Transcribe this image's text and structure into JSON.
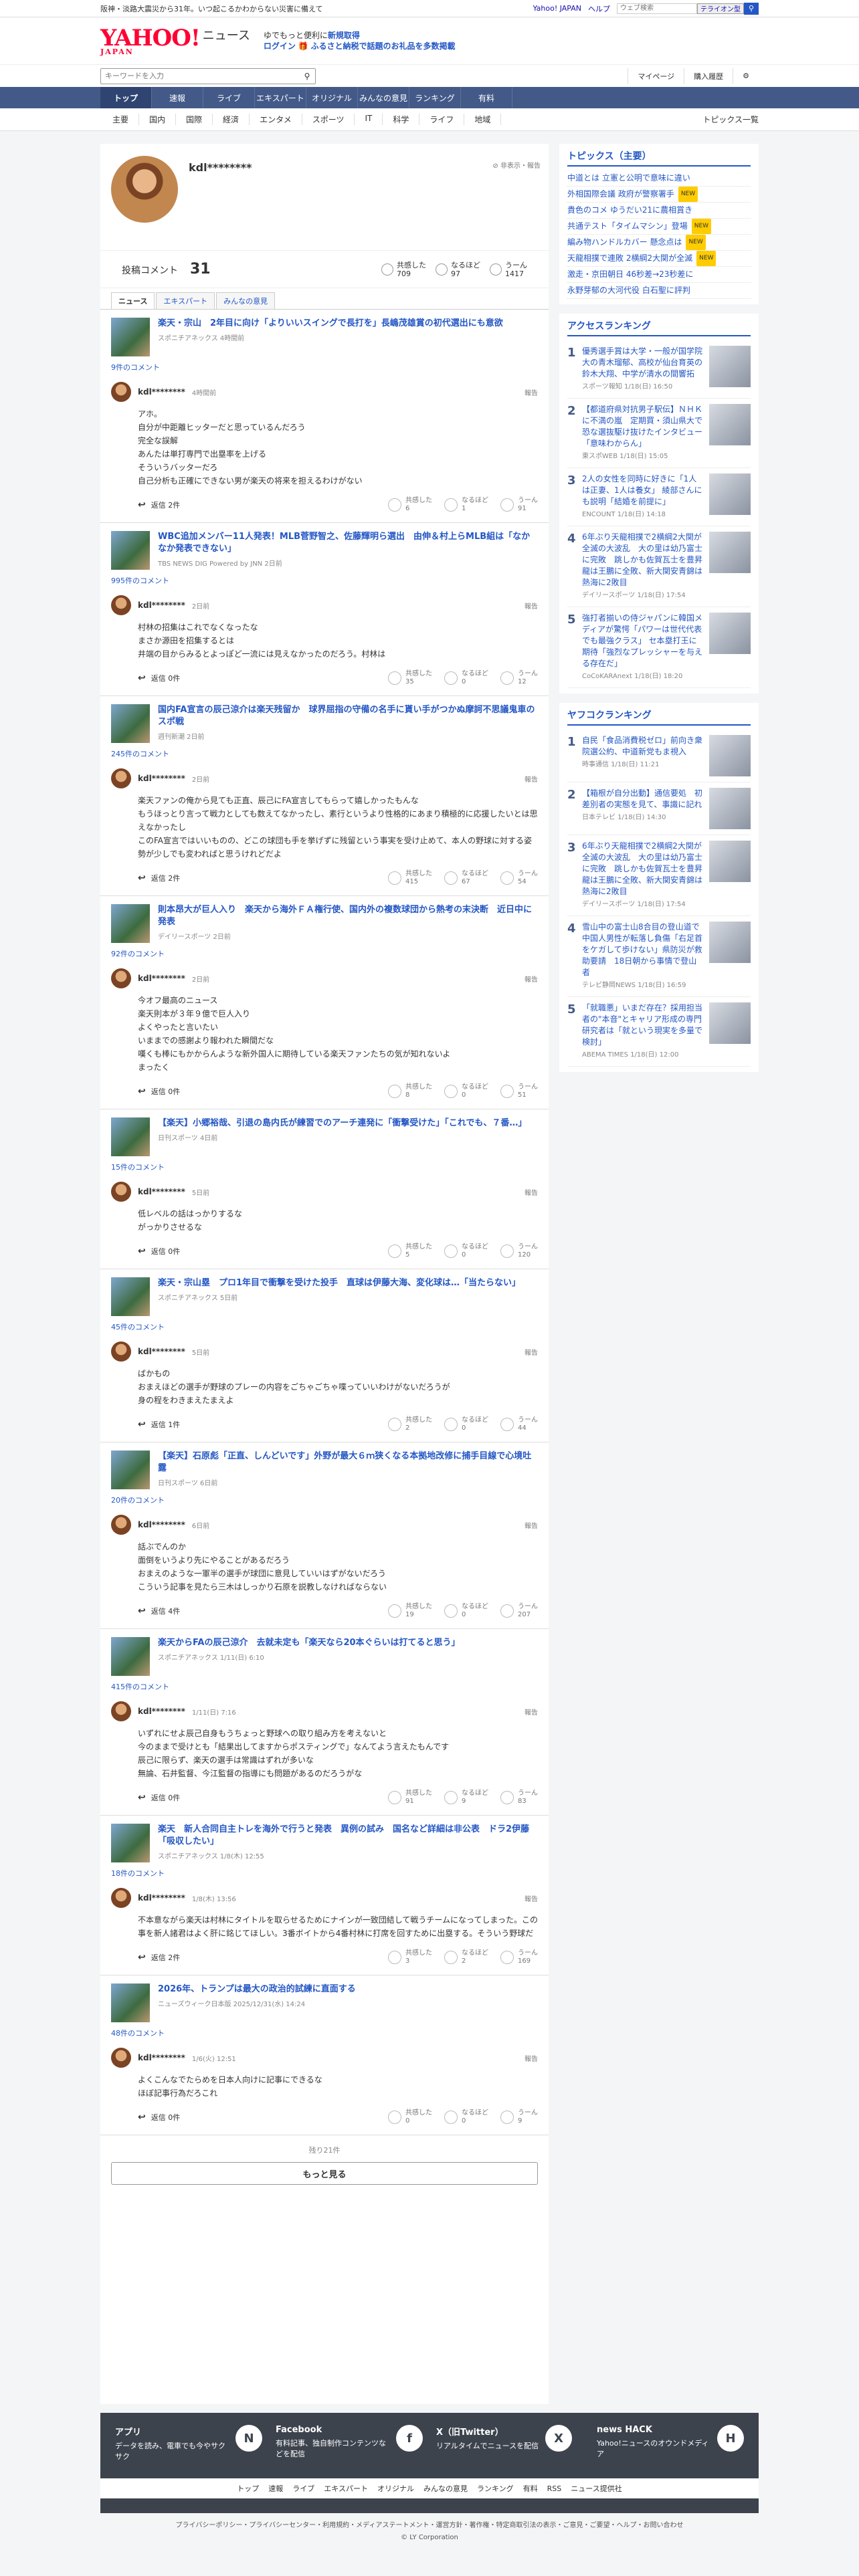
{
  "topbar": {
    "news": "阪神・淡路大震災から31年。いつ起こるかわからない災害に備えて",
    "yahoo_japan": "Yahoo! JAPAN",
    "help": "ヘルプ",
    "search_placeholder": "ウェブ検索",
    "search_btn": "テライオン型"
  },
  "brand": {
    "logo": "YAHOO!",
    "logo_sub": "JAPAN",
    "news": "ニュース",
    "promo1": "ゆでもっと便利に",
    "promo1_b": "新規取得",
    "promo2_login": "ログイン",
    "promo2": "ふるさと納税で話題のお礼品を多数掲載"
  },
  "toolbar": {
    "keyword_placeholder": "キーワードを入力",
    "mypage": "マイページ",
    "purchase": "購入履歴"
  },
  "mainnav": [
    "トップ",
    "速報",
    "ライブ",
    "エキスパート",
    "オリジナル",
    "みんなの意見",
    "ランキング",
    "有料"
  ],
  "subnav": {
    "items": [
      "主要",
      "国内",
      "国際",
      "経済",
      "エンタメ",
      "スポーツ",
      "IT",
      "科学",
      "ライフ",
      "地域"
    ],
    "all": "トピックス一覧"
  },
  "profile": {
    "name": "kdl********",
    "report": "非表示・報告",
    "post_label": "投稿コメント",
    "post_count": "31",
    "stats": [
      {
        "label": "共感した",
        "value": "709"
      },
      {
        "label": "なるほど",
        "value": "97"
      },
      {
        "label": "うーん",
        "value": "1417"
      }
    ]
  },
  "tabs": [
    "ニュース",
    "エキスパート",
    "みんなの意見"
  ],
  "entries": [
    {
      "title": "楽天・宗山　2年目に向け「よりいいスイングで長打を」長嶋茂雄賞の初代選出にも意欲",
      "src": "スポニチアネックス 4時間前",
      "clink": "9件のコメント",
      "user": "kdl********",
      "time": "4時間前",
      "report": "報告",
      "body": "アホ。\n自分が中距離ヒッターだと思っているんだろう\n完全な誤解\nあんたは単打専門で出塁率を上げる\nそういうバッターだろ\n自己分析も正確にできない男が楽天の将来を担えるわけがない",
      "reply": "返信 2件",
      "r1": "6",
      "r2": "1",
      "r3": "91"
    },
    {
      "title": "WBC追加メンバー11人発表！MLB菅野智之、佐藤輝明ら選出　由伸＆村上らMLB組は「なかなか発表できない」",
      "src": "TBS NEWS DIG Powered by JNN 2日前",
      "clink": "995件のコメント",
      "user": "kdl********",
      "time": "2日前",
      "report": "報告",
      "body": "村林の招集はこれでなくなったな\nまさか源田を招集するとは\n井端の目からみるとよっぽど一流には見えなかったのだろう。村林は",
      "reply": "返信 0件",
      "r1": "35",
      "r2": "0",
      "r3": "12"
    },
    {
      "title": "国内FA宣言の辰己涼介は楽天残留か　球界屈指の守備の名手に貰い手がつかぬ摩訶不思議鬼車のスポ戦",
      "src": "週刊新潮 2日前",
      "clink": "245件のコメント",
      "user": "kdl********",
      "time": "2日前",
      "report": "報告",
      "body": "楽天ファンの俺から見ても正直、辰己にFA宣言してもらって嬉しかったもんな\nもうほっとり言って戦力としても数えてなかったし、素行というより性格的にあまり積極的に応援したいとは思えなかったし\nこのFA宣言ではいいものの、どこの球団も手を挙げずに残留という事実を受け止めて、本人の野球に対する姿勢が少しでも変わればと思うけれどだよ",
      "reply": "返信 2件",
      "r1": "415",
      "r2": "67",
      "r3": "54"
    },
    {
      "title": "則本昂大が巨人入り　楽天から海外ＦＡ権行使、国内外の複数球団から熱考の末決断　近日中に発表",
      "src": "デイリースポーツ 2日前",
      "clink": "92件のコメント",
      "user": "kdl********",
      "time": "2日前",
      "report": "報告",
      "body": "今オフ最高のニュース\n楽天則本が３年９億で巨人入り\nよくやったと言いたい\nいままでの感謝より報われた瞬間だな\n嘆くも棒にもかからんような新外国人に期待している楽天ファンたちの気が知れないよ\nまったく",
      "reply": "返信 0件",
      "r1": "8",
      "r2": "0",
      "r3": "51"
    },
    {
      "title": "【楽天】小郷裕哉、引退の島内氏が練習でのアーチ連発に「衝撃受けた」「これでも、７番…」",
      "src": "日刊スポーツ 4日前",
      "clink": "15件のコメント",
      "user": "kdl********",
      "time": "5日前",
      "report": "報告",
      "body": "低レベルの話はっかりするな\nがっかりさせるな",
      "reply": "返信 0件",
      "r1": "5",
      "r2": "0",
      "r3": "120"
    },
    {
      "title": "楽天・宗山塁　プロ1年目で衝撃を受けた投手　直球は伊藤大海、変化球は…「当たらない」",
      "src": "スポニチアネックス 5日前",
      "clink": "45件のコメント",
      "user": "kdl********",
      "time": "5日前",
      "report": "報告",
      "body": "ばかもの\nおまえほどの選手が野球のプレーの内容をごちゃごちゃ喋っていいわけがないだろうが\n身の程をわきまえたまえよ",
      "reply": "返信 1件",
      "r1": "2",
      "r2": "0",
      "r3": "44"
    },
    {
      "title": "【楽天】石原彪「正直、しんどいです」外野が最大６ｍ狭くなる本拠地改修に捕手目線で心境吐露",
      "src": "日刊スポーツ 6日前",
      "clink": "20件のコメント",
      "user": "kdl********",
      "time": "6日前",
      "report": "報告",
      "body": "話ぶでんのか\n面倒をいうより先にやることがあるだろう\nおまえのような一軍半の選手が球団に意見していいはずがないだろう\nこういう記事を見たら三木はしっかり石原を説教しなければならない",
      "reply": "返信 4件",
      "r1": "19",
      "r2": "0",
      "r3": "207"
    },
    {
      "title": "楽天からFAの辰己涼介　去就未定も「楽天なら20本ぐらいは打てると思う」",
      "src": "スポニチアネックス 1/11(日) 6:10",
      "clink": "415件のコメント",
      "user": "kdl********",
      "time": "1/11(日) 7:16",
      "report": "報告",
      "body": "いずれにせよ辰己自身もうちょっと野球への取り組み方を考えないと\n今のままで受けとも「結果出してますからポスティングで」なんてよう言えたもんです\n辰己に限らず、楽天の選手は常識はずれが多いな\n無論、石井監督、今江監督の指導にも問題があるのだろうがな",
      "reply": "返信 0件",
      "r1": "91",
      "r2": "9",
      "r3": "83"
    },
    {
      "title": "楽天　新人合同自主トレを海外で行うと発表　異例の試み　国名など詳細は非公表　ドラ2伊藤「吸収したい」",
      "src": "スポニチアネックス 1/8(木) 12:55",
      "clink": "18件のコメント",
      "user": "kdl********",
      "time": "1/8(木) 13:56",
      "report": "報告",
      "body": "不本意ながら楽天は村林にタイトルを取らせるためにナインが一致団結して戦うチームになってしまった。この事を新人諸君はよく肝に銘じてほしい。3番ボイトから4番村林に打席を回すために出塁する。そういう野球だ",
      "reply": "返信 2件",
      "r1": "3",
      "r2": "2",
      "r3": "169"
    },
    {
      "title": "2026年、トランプは最大の政治的試練に直面する",
      "src": "ニューズウィーク日本版 2025/12/31(水) 14:24",
      "clink": "48件のコメント",
      "user": "kdl********",
      "time": "1/6(火) 12:51",
      "report": "報告",
      "body": "よくこんなでたらめを日本人向けに記事にできるな\nほぼ記事行為だろこれ",
      "reply": "返信 0件",
      "r1": "0",
      "r2": "0",
      "r3": "9"
    }
  ],
  "more": {
    "rest": "残り21件",
    "btn": "もっと見る"
  },
  "right": {
    "topics_title": "トピックス（主要）",
    "topics": [
      {
        "t": "中道とは 立憲と公明で意味に違い",
        "n": ""
      },
      {
        "t": "外相国際会議 政府が警察署手",
        "n": "NEW"
      },
      {
        "t": "貴色のコメ ゆうだい21に農相賞き",
        "n": ""
      },
      {
        "t": "共通テスト「タイムマシン」登場",
        "n": "NEW"
      },
      {
        "t": "編み物ハンドルカバー 懸念点は",
        "n": "NEW"
      },
      {
        "t": "天龍相撲で連敗 2横綱2大関が全滅",
        "n": "NEW"
      },
      {
        "t": "激走・京田朝日 46秒差→23秒差に",
        "n": ""
      },
      {
        "t": "永野芽郁の大河代役 白石聖に評判",
        "n": ""
      }
    ],
    "access_title": "アクセスランキング",
    "access": [
      {
        "n": "1",
        "t": "優秀選手賞は大学・一般が国学院大の青木瑠郁、高校が仙台育英の鈴木大翔、中学が清水の間響拓",
        "s": "スポーツ報知 1/18(日) 16:50"
      },
      {
        "n": "2",
        "t": "【都道府県対抗男子駅伝】ＮＨＫに不満の嵐　定期買・須山県大で恐な選抜駆け抜けたインタビュー「意味わからん」",
        "s": "東スポWEB 1/18(日) 15:05"
      },
      {
        "n": "3",
        "t": "2人の女性を同時に好きに「1人は正妻、1人は養女」 綾部さんにも説明「結婚を前提に」",
        "s": "ENCOUNT 1/18(日) 14:18"
      },
      {
        "n": "4",
        "t": "6年ぶり天龍相撲で2横綱2大関が全滅の大波乱　大の里は幼乃富士に完敗　跳しかも佐賀瓦士を豊昇龍は王鵬に全敗、新大関安青錦は熱海に2敗目",
        "s": "デイリースポーツ 1/18(日) 17:54"
      },
      {
        "n": "5",
        "t": "強打者揃いの侍ジャパンに韓国メディアが驚愕「パワーは世代代表でも最強クラス」 セ本塁打王に期待「強烈なプレッシャーを与える存在だ」",
        "s": "CoCoKARAnext 1/18(日) 18:20"
      }
    ],
    "yafoco_title": "ヤフコクランキング",
    "yafoco": [
      {
        "n": "1",
        "t": "自民「食品消費税ゼロ」前向き衆院選公約、中道新党もま視入",
        "s": "時事通信 1/18(日) 11:21"
      },
      {
        "n": "2",
        "t": "【箱根が自分出動】通信要処　初差別者の実態を見て、事識に記れ",
        "s": "日本テレビ 1/18(日) 14:30"
      },
      {
        "n": "3",
        "t": "6年ぶり天龍相撲で2横綱2大関が全滅の大波乱　大の里は幼乃富士に完敗　跳しかも佐賀瓦士を豊昇龍は王鵬に全敗、新大関安青錦は熱海に2敗目",
        "s": "デイリースポーツ 1/18(日) 17:54"
      },
      {
        "n": "4",
        "t": "雪山中の富士山8合目の登山道で中国人男性が転落し負傷「右足首をケガして歩けない」県防災が救助要請　18日朝から事情で登山者",
        "s": "テレビ静岡NEWS 1/18(日) 16:59"
      },
      {
        "n": "5",
        "t": "「就職悪」いまだ存在？採用担当者の\"本音\"とキャリア形成の専門研究者は「就という現実を多量で検討」",
        "s": "ABEMA TIMES 1/18(日) 12:00"
      }
    ]
  },
  "footer": {
    "apps": [
      {
        "title": "アプリ",
        "text": "データを読み、電車でも今やサクサク",
        "icon": "N"
      },
      {
        "title": "Facebook",
        "text": "有料記事、独自制作コンテンツなどを配信",
        "icon": "f"
      },
      {
        "title": "X（旧Twitter）",
        "text": "リアルタイムでニュースを配信",
        "icon": "X"
      },
      {
        "title": "news HACK",
        "text": "Yahoo!ニュースのオウンドメディア",
        "icon": "H"
      }
    ],
    "links": [
      "トップ",
      "速報",
      "ライブ",
      "エキスパート",
      "オリジナル",
      "みんなの意見",
      "ランキング",
      "有料",
      "RSS",
      "ニュース提供社"
    ],
    "legal": "プライバシーポリシー・プライバシーセンター・利用規約・メディアステートメント・運営方針・著作権・特定商取引法の表示・ご意見・ご要望・ヘルプ・お問い合わせ",
    "copyright": "© LY Corporation"
  }
}
